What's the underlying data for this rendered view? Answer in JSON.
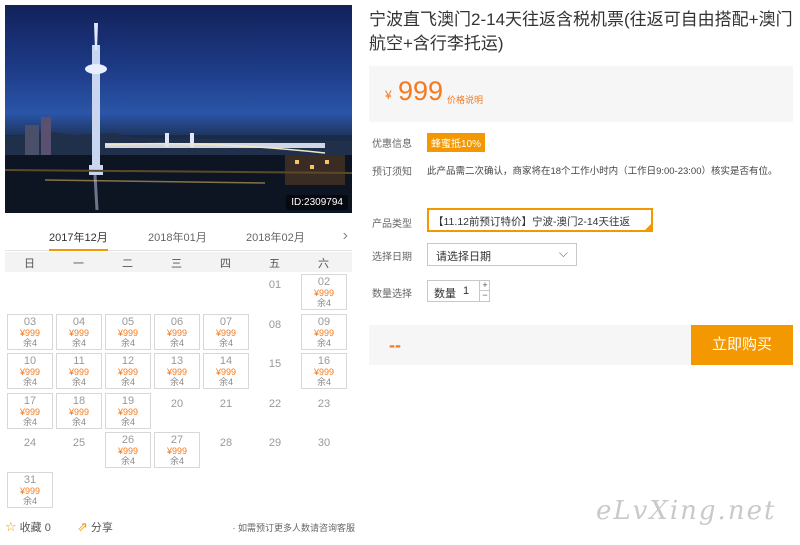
{
  "photo": {
    "id_label": "ID:2309794"
  },
  "calendar": {
    "months": [
      "2017年12月",
      "2018年01月",
      "2018年02月"
    ],
    "next_icon": "chevron-right-icon",
    "weekdays": [
      "日",
      "一",
      "二",
      "三",
      "四",
      "五",
      "六"
    ],
    "price": "¥999",
    "remain": "余4",
    "dates": [
      "01",
      "02",
      "03",
      "04",
      "05",
      "06",
      "07",
      "08",
      "09",
      "10",
      "11",
      "12",
      "13",
      "14",
      "15",
      "16",
      "17",
      "18",
      "19",
      "20",
      "21",
      "22",
      "23",
      "24",
      "25",
      "26",
      "27",
      "28",
      "29",
      "30",
      "31"
    ],
    "available_dates": [
      "02",
      "03",
      "04",
      "05",
      "06",
      "07",
      "09",
      "10",
      "11",
      "12",
      "13",
      "14",
      "16",
      "17",
      "18",
      "19",
      "26",
      "27",
      "31"
    ]
  },
  "actions": {
    "favorite_label": "收藏 0",
    "share_label": "分享",
    "note": "· 如需预订更多人数请咨询客服"
  },
  "product": {
    "title": "宁波直飞澳门2-14天往返含税机票(往返可自由搭配+澳门航空+含行李托运)",
    "price_symbol": "¥",
    "price_value": "999",
    "price_link": "价格说明",
    "discount_label": "优惠信息",
    "discount_badge": "蜂蜜抵10%",
    "notice_label": "预订须知",
    "notice_text": "此产品需二次确认，商家将在18个工作小时内（工作日9:00-23:00）核实是否有位。",
    "type_label": "产品类型",
    "type_value": "【11.12前预订特价】宁波-澳门2-14天往返",
    "date_label": "选择日期",
    "date_value": "请选择日期",
    "qty_label": "数量选择",
    "qty_inner_label": "数量",
    "qty_value": "1",
    "total": "--",
    "buy_label": "立即购买"
  },
  "watermark": "eLvXing.net",
  "colors": {
    "accent": "#f39800",
    "price": "#f37a1f"
  }
}
